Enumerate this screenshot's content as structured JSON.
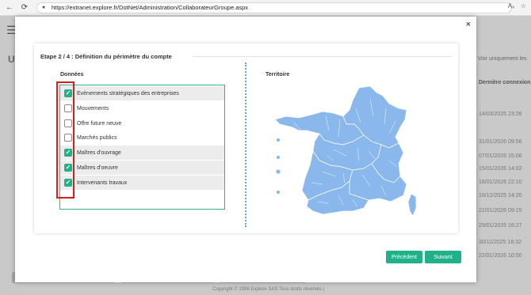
{
  "browser": {
    "url": "https://extranet.explore.fr/DotNet/Administration/CollaborateurGroupe.aspx",
    "back_icon": "back-arrow-icon",
    "reload_icon": "reload-icon"
  },
  "background": {
    "first_letter": "U",
    "filter_text": "Voir uniquement les",
    "column_header": "Dernière connexion",
    "dates": [
      "14/03/2025 23:26",
      "31/01/2026 09:56",
      "07/01/2026 15:06",
      "15/01/2026 14:02",
      "16/01/2026 22:10",
      "16/12/2025 14:20",
      "22/01/2026 09:15",
      "29/01/2026 16:27",
      "30/11/2025 18:32",
      "22/01/2026 10:50"
    ],
    "footer": "Copyright © 1998 Explore SAS Tous droits réservés |"
  },
  "modal": {
    "close_label": "×",
    "step_title": "Etape 2 / 4 : Définition du périmètre du compte",
    "donnees_label": "Données",
    "territoire_label": "Territoire",
    "items": [
      {
        "label": "Evènements stratégiques des entreprises",
        "checked": true
      },
      {
        "label": "Mouvements",
        "checked": false
      },
      {
        "label": "Offre future neuve",
        "checked": false
      },
      {
        "label": "Marchés publics",
        "checked": false
      },
      {
        "label": "Maîtres d'ouvrage",
        "checked": true
      },
      {
        "label": "Maîtres d'oeuvre",
        "checked": true
      },
      {
        "label": "Intervenants travaux",
        "checked": true
      }
    ],
    "prev_button": "Précédent",
    "next_button": "Suivant",
    "colors": {
      "accent": "#20b189",
      "map_fill": "#8ab8ec",
      "highlight": "#d91d1d"
    }
  }
}
